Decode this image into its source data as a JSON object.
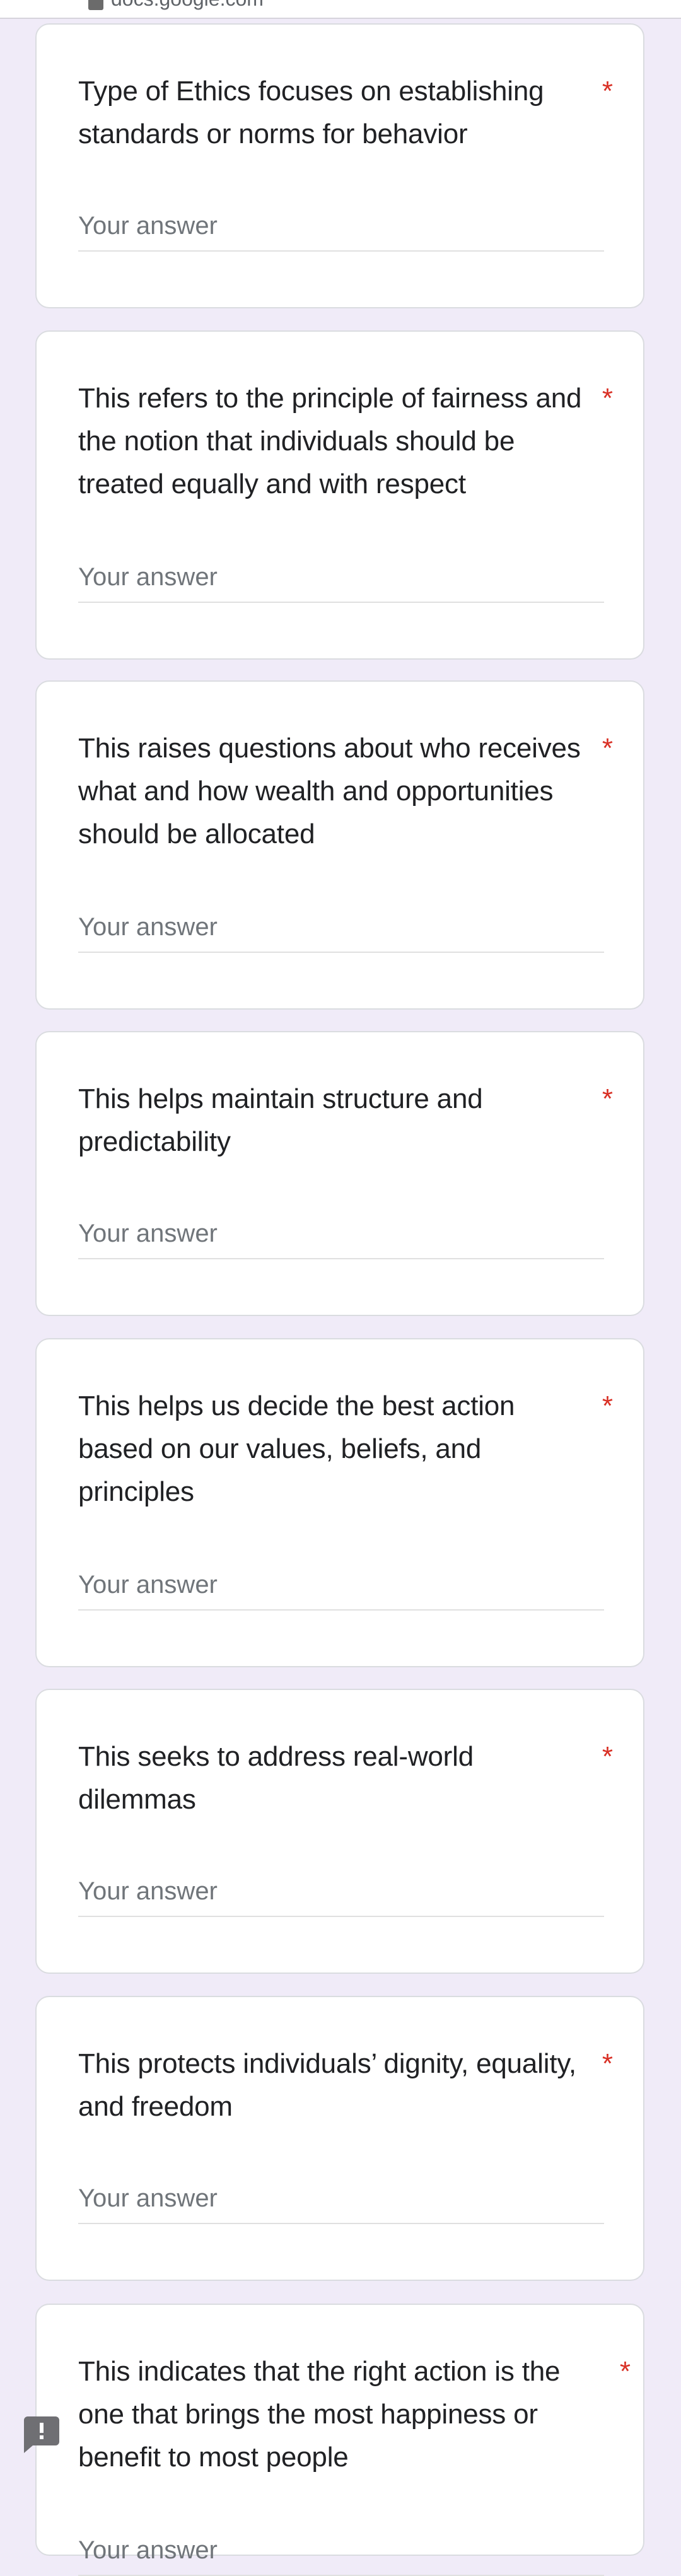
{
  "browser": {
    "url": "docs.google.com",
    "lock_icon": "lock-icon"
  },
  "form": {
    "accent_color": "#673ab7",
    "required_color": "#d93025",
    "questions": [
      {
        "text": "Type of Ethics focuses on establishing standards or norms for behavior",
        "required_marker": "*",
        "answer_placeholder": "Your answer",
        "answer_value": ""
      },
      {
        "text": "This refers to the principle of fairness and the notion that individuals should be treated equally and with respect",
        "required_marker": "*",
        "answer_placeholder": "Your answer",
        "answer_value": ""
      },
      {
        "text": "This raises questions about who receives what and how wealth and opportunities should be allocated",
        "required_marker": "*",
        "answer_placeholder": "Your answer",
        "answer_value": ""
      },
      {
        "text": "This helps maintain structure and predictability",
        "required_marker": "*",
        "answer_placeholder": "Your answer",
        "answer_value": ""
      },
      {
        "text": "This helps us decide the best action based on our values, beliefs, and principles",
        "required_marker": "*",
        "answer_placeholder": "Your answer",
        "answer_value": ""
      },
      {
        "text": "This seeks to address real-world dilemmas",
        "required_marker": "*",
        "answer_placeholder": "Your answer",
        "answer_value": ""
      },
      {
        "text": "This protects individuals’ dignity, equality, and freedom",
        "required_marker": "*",
        "answer_placeholder": "Your answer",
        "answer_value": ""
      },
      {
        "text": "This indicates that the right action is the one that brings the most happiness or benefit to most people",
        "required_marker": "*",
        "answer_placeholder": "Your answer",
        "answer_value": ""
      }
    ]
  },
  "feedback_button": {
    "icon": "report-problem-icon"
  }
}
